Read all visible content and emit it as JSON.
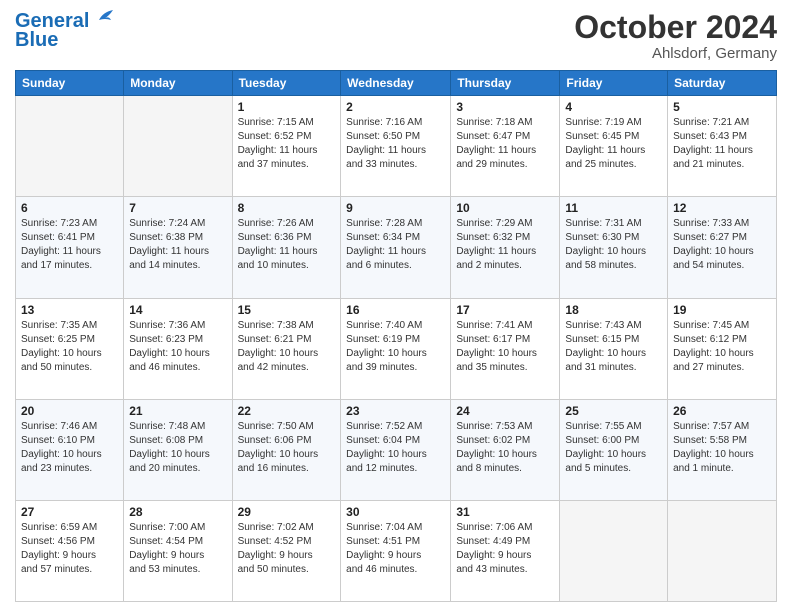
{
  "header": {
    "logo_line1": "General",
    "logo_line2": "Blue",
    "month": "October 2024",
    "location": "Ahlsdorf, Germany"
  },
  "days_of_week": [
    "Sunday",
    "Monday",
    "Tuesday",
    "Wednesday",
    "Thursday",
    "Friday",
    "Saturday"
  ],
  "weeks": [
    [
      {
        "day": "",
        "content": ""
      },
      {
        "day": "",
        "content": ""
      },
      {
        "day": "1",
        "content": "Sunrise: 7:15 AM\nSunset: 6:52 PM\nDaylight: 11 hours\nand 37 minutes."
      },
      {
        "day": "2",
        "content": "Sunrise: 7:16 AM\nSunset: 6:50 PM\nDaylight: 11 hours\nand 33 minutes."
      },
      {
        "day": "3",
        "content": "Sunrise: 7:18 AM\nSunset: 6:47 PM\nDaylight: 11 hours\nand 29 minutes."
      },
      {
        "day": "4",
        "content": "Sunrise: 7:19 AM\nSunset: 6:45 PM\nDaylight: 11 hours\nand 25 minutes."
      },
      {
        "day": "5",
        "content": "Sunrise: 7:21 AM\nSunset: 6:43 PM\nDaylight: 11 hours\nand 21 minutes."
      }
    ],
    [
      {
        "day": "6",
        "content": "Sunrise: 7:23 AM\nSunset: 6:41 PM\nDaylight: 11 hours\nand 17 minutes."
      },
      {
        "day": "7",
        "content": "Sunrise: 7:24 AM\nSunset: 6:38 PM\nDaylight: 11 hours\nand 14 minutes."
      },
      {
        "day": "8",
        "content": "Sunrise: 7:26 AM\nSunset: 6:36 PM\nDaylight: 11 hours\nand 10 minutes."
      },
      {
        "day": "9",
        "content": "Sunrise: 7:28 AM\nSunset: 6:34 PM\nDaylight: 11 hours\nand 6 minutes."
      },
      {
        "day": "10",
        "content": "Sunrise: 7:29 AM\nSunset: 6:32 PM\nDaylight: 11 hours\nand 2 minutes."
      },
      {
        "day": "11",
        "content": "Sunrise: 7:31 AM\nSunset: 6:30 PM\nDaylight: 10 hours\nand 58 minutes."
      },
      {
        "day": "12",
        "content": "Sunrise: 7:33 AM\nSunset: 6:27 PM\nDaylight: 10 hours\nand 54 minutes."
      }
    ],
    [
      {
        "day": "13",
        "content": "Sunrise: 7:35 AM\nSunset: 6:25 PM\nDaylight: 10 hours\nand 50 minutes."
      },
      {
        "day": "14",
        "content": "Sunrise: 7:36 AM\nSunset: 6:23 PM\nDaylight: 10 hours\nand 46 minutes."
      },
      {
        "day": "15",
        "content": "Sunrise: 7:38 AM\nSunset: 6:21 PM\nDaylight: 10 hours\nand 42 minutes."
      },
      {
        "day": "16",
        "content": "Sunrise: 7:40 AM\nSunset: 6:19 PM\nDaylight: 10 hours\nand 39 minutes."
      },
      {
        "day": "17",
        "content": "Sunrise: 7:41 AM\nSunset: 6:17 PM\nDaylight: 10 hours\nand 35 minutes."
      },
      {
        "day": "18",
        "content": "Sunrise: 7:43 AM\nSunset: 6:15 PM\nDaylight: 10 hours\nand 31 minutes."
      },
      {
        "day": "19",
        "content": "Sunrise: 7:45 AM\nSunset: 6:12 PM\nDaylight: 10 hours\nand 27 minutes."
      }
    ],
    [
      {
        "day": "20",
        "content": "Sunrise: 7:46 AM\nSunset: 6:10 PM\nDaylight: 10 hours\nand 23 minutes."
      },
      {
        "day": "21",
        "content": "Sunrise: 7:48 AM\nSunset: 6:08 PM\nDaylight: 10 hours\nand 20 minutes."
      },
      {
        "day": "22",
        "content": "Sunrise: 7:50 AM\nSunset: 6:06 PM\nDaylight: 10 hours\nand 16 minutes."
      },
      {
        "day": "23",
        "content": "Sunrise: 7:52 AM\nSunset: 6:04 PM\nDaylight: 10 hours\nand 12 minutes."
      },
      {
        "day": "24",
        "content": "Sunrise: 7:53 AM\nSunset: 6:02 PM\nDaylight: 10 hours\nand 8 minutes."
      },
      {
        "day": "25",
        "content": "Sunrise: 7:55 AM\nSunset: 6:00 PM\nDaylight: 10 hours\nand 5 minutes."
      },
      {
        "day": "26",
        "content": "Sunrise: 7:57 AM\nSunset: 5:58 PM\nDaylight: 10 hours\nand 1 minute."
      }
    ],
    [
      {
        "day": "27",
        "content": "Sunrise: 6:59 AM\nSunset: 4:56 PM\nDaylight: 9 hours\nand 57 minutes."
      },
      {
        "day": "28",
        "content": "Sunrise: 7:00 AM\nSunset: 4:54 PM\nDaylight: 9 hours\nand 53 minutes."
      },
      {
        "day": "29",
        "content": "Sunrise: 7:02 AM\nSunset: 4:52 PM\nDaylight: 9 hours\nand 50 minutes."
      },
      {
        "day": "30",
        "content": "Sunrise: 7:04 AM\nSunset: 4:51 PM\nDaylight: 9 hours\nand 46 minutes."
      },
      {
        "day": "31",
        "content": "Sunrise: 7:06 AM\nSunset: 4:49 PM\nDaylight: 9 hours\nand 43 minutes."
      },
      {
        "day": "",
        "content": ""
      },
      {
        "day": "",
        "content": ""
      }
    ]
  ]
}
